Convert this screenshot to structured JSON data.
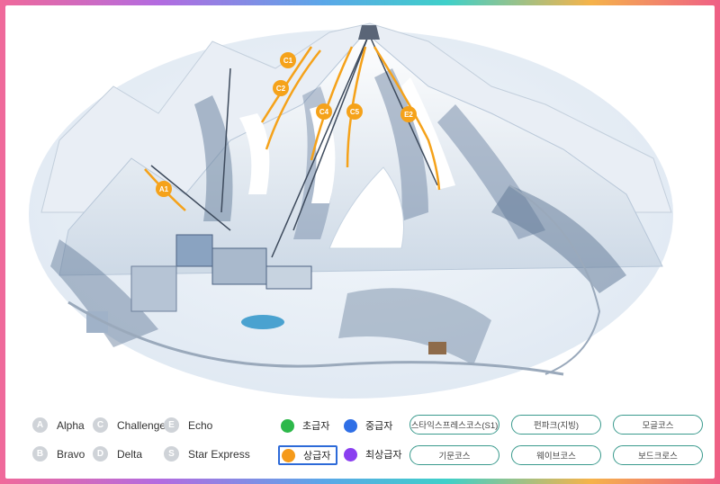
{
  "lifts": [
    {
      "letter": "A",
      "name": "Alpha"
    },
    {
      "letter": "C",
      "name": "Challenge"
    },
    {
      "letter": "E",
      "name": "Echo"
    },
    {
      "letter": "B",
      "name": "Bravo"
    },
    {
      "letter": "D",
      "name": "Delta"
    },
    {
      "letter": "S",
      "name": "Star Express"
    }
  ],
  "levels": [
    {
      "label": "초급자",
      "color": "#2db84a"
    },
    {
      "label": "중급자",
      "color": "#2f6fe6"
    },
    {
      "label": "상급자",
      "color": "#f59a1a",
      "selected": true
    },
    {
      "label": "최상급자",
      "color": "#8a3ff0"
    }
  ],
  "courses": [
    "스타익스프레스코스(S1)",
    "펀파크(지빙)",
    "모글코스",
    "기문코스",
    "웨이브코스",
    "보드크로스"
  ],
  "map_labels": [
    "C1",
    "C2",
    "C4",
    "C5",
    "E2",
    "A1"
  ],
  "colors": {
    "course_line": "#f5a21a",
    "button_border": "#3a9a8d",
    "selected_border": "#2d6ad8"
  }
}
